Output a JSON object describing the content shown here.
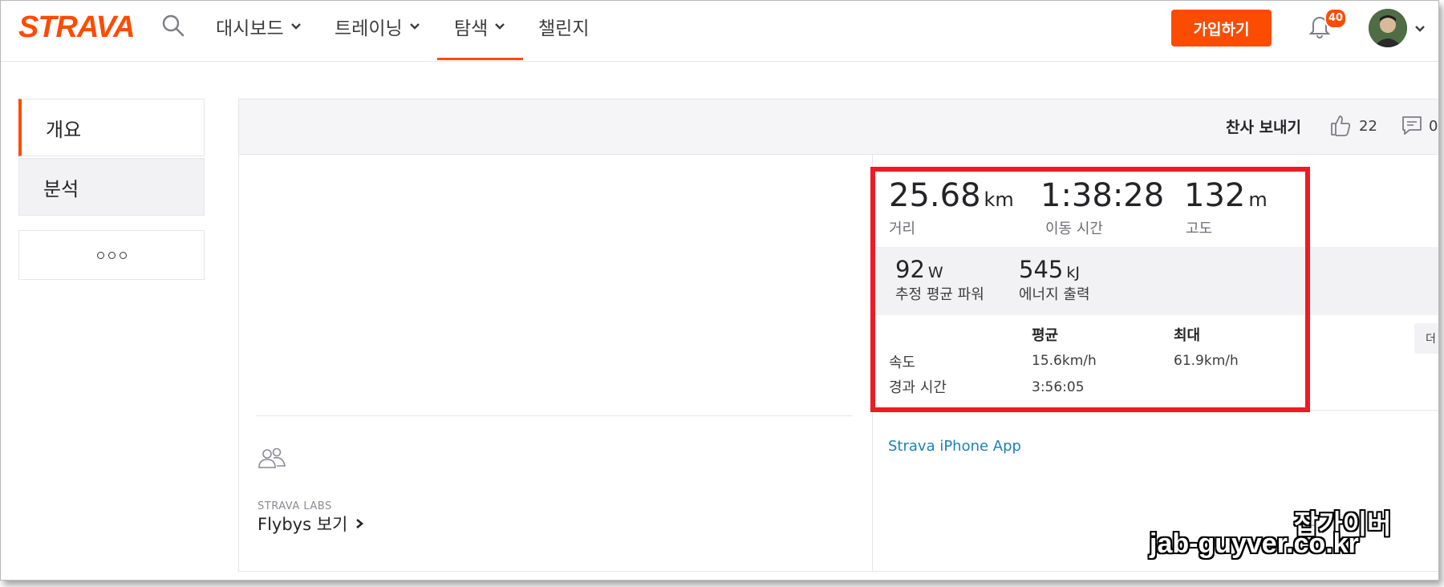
{
  "header": {
    "logo": "STRAVA",
    "nav": [
      {
        "label": "대시보드"
      },
      {
        "label": "트레이닝"
      },
      {
        "label": "탐색"
      },
      {
        "label": "챌린지"
      }
    ],
    "signup_label": "가입하기",
    "notification_count": "40",
    "accent_color": "#fc4c02"
  },
  "sidebar": {
    "tabs": [
      {
        "label": "개요"
      },
      {
        "label": "분석"
      }
    ],
    "more_icon": "more-dots-icon"
  },
  "actions": {
    "kudos_label": "찬사 보내기",
    "kudos_count": "22",
    "comment_count": "0"
  },
  "stats": {
    "distance": {
      "value": "25.68",
      "unit": "km",
      "label": "거리"
    },
    "moving_time": {
      "value": "1:38:28",
      "label": "이동 시간"
    },
    "elevation": {
      "value": "132",
      "unit": "m",
      "label": "고도"
    },
    "power": {
      "value": "92",
      "unit": "W",
      "label": "추정 평균 파워"
    },
    "energy": {
      "value": "545",
      "unit": "kJ",
      "label": "에너지 출력"
    },
    "table": {
      "col_avg": "평균",
      "col_max": "최대",
      "rows": [
        {
          "label": "속도",
          "avg": "15.6km/h",
          "max": "61.9km/h"
        },
        {
          "label": "경과 시간",
          "avg": "3:56:05",
          "max": ""
        }
      ]
    }
  },
  "device": "Strava iPhone App",
  "side_button_label": "더",
  "labs": {
    "small_label": "STRAVA LABS",
    "flybys_label": "Flybys 보기"
  },
  "watermark": {
    "line1": "잡가이버",
    "line2": "jab-guyver.co.kr"
  }
}
